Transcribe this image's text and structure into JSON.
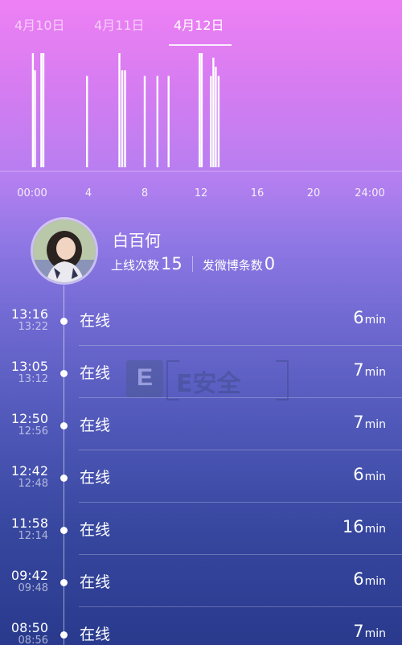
{
  "tabs": [
    {
      "label": "4月10日",
      "active": false
    },
    {
      "label": "4月11日",
      "active": false
    },
    {
      "label": "4月12日",
      "active": true
    }
  ],
  "chart_data": {
    "type": "bar",
    "x_unit": "hour",
    "xlim": [
      0,
      24
    ],
    "tick_labels": [
      "00:00",
      "4",
      "8",
      "12",
      "16",
      "20",
      "24:00"
    ],
    "tick_hours": [
      0,
      4,
      8,
      12,
      16,
      20,
      24
    ],
    "bars": [
      {
        "hour": 0.05,
        "value": 1.0
      },
      {
        "hour": 0.2,
        "value": 0.85
      },
      {
        "hour": 0.65,
        "value": 1.0
      },
      {
        "hour": 0.8,
        "value": 1.0
      },
      {
        "hour": 3.9,
        "value": 0.8
      },
      {
        "hour": 6.2,
        "value": 1.0
      },
      {
        "hour": 6.4,
        "value": 0.85
      },
      {
        "hour": 6.6,
        "value": 0.85
      },
      {
        "hour": 8.0,
        "value": 0.8
      },
      {
        "hour": 8.9,
        "value": 0.8
      },
      {
        "hour": 9.7,
        "value": 0.8
      },
      {
        "hour": 11.9,
        "value": 1.0
      },
      {
        "hour": 12.05,
        "value": 1.0
      },
      {
        "hour": 12.7,
        "value": 0.8
      },
      {
        "hour": 12.88,
        "value": 0.96
      },
      {
        "hour": 13.05,
        "value": 0.88
      },
      {
        "hour": 13.25,
        "value": 0.8
      }
    ],
    "color": "#ffffff"
  },
  "profile": {
    "name": "白百何",
    "online_label": "上线次数",
    "online_count": "15",
    "posts_label": "发微博条数",
    "posts_count": "0"
  },
  "sessions": [
    {
      "start": "13:16",
      "end": "13:22",
      "status": "在线",
      "duration": "6",
      "unit": "min"
    },
    {
      "start": "13:05",
      "end": "13:12",
      "status": "在线",
      "duration": "7",
      "unit": "min"
    },
    {
      "start": "12:50",
      "end": "12:56",
      "status": "在线",
      "duration": "7",
      "unit": "min"
    },
    {
      "start": "12:42",
      "end": "12:48",
      "status": "在线",
      "duration": "6",
      "unit": "min"
    },
    {
      "start": "11:58",
      "end": "12:14",
      "status": "在线",
      "duration": "16",
      "unit": "min"
    },
    {
      "start": "09:42",
      "end": "09:48",
      "status": "在线",
      "duration": "6",
      "unit": "min"
    },
    {
      "start": "08:50",
      "end": "08:56",
      "status": "在线",
      "duration": "7",
      "unit": "min"
    }
  ],
  "watermark": {
    "logo_letter": "E",
    "text": "E安全"
  }
}
